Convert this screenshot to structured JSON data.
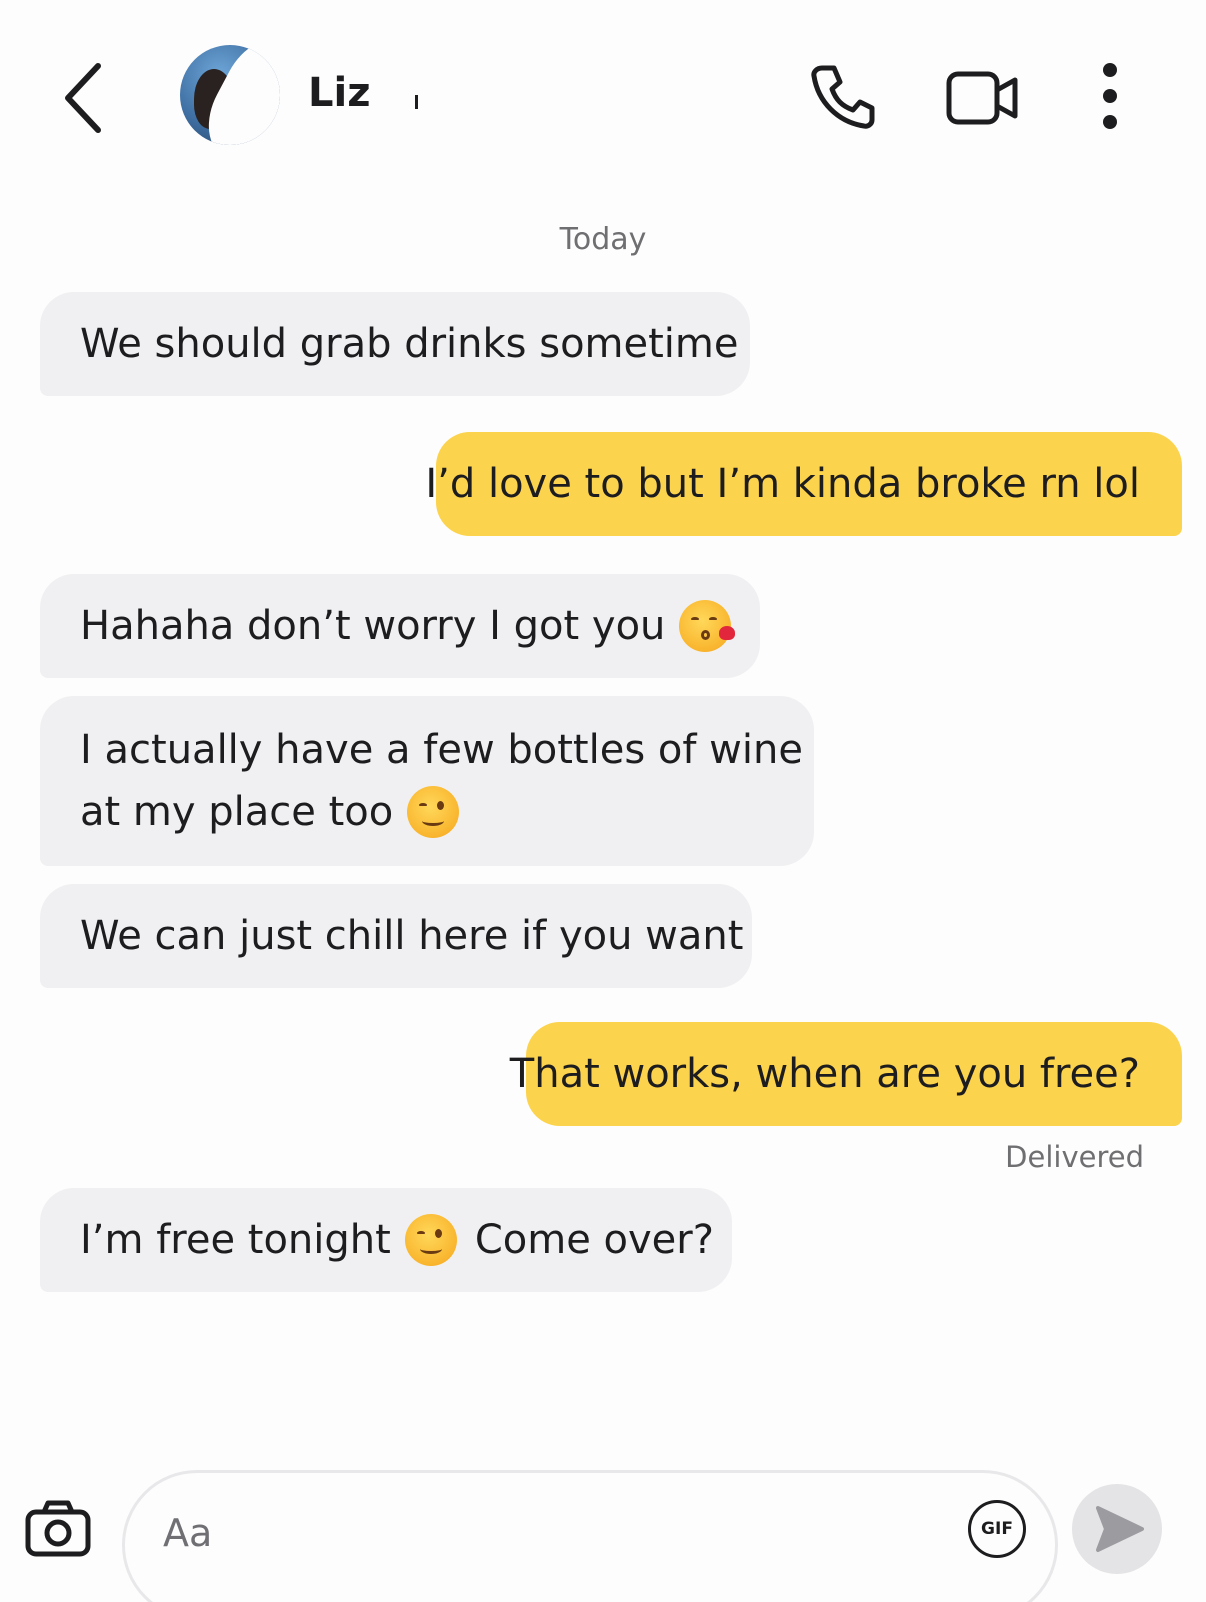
{
  "header": {
    "contact_name": "Liz"
  },
  "conversation": {
    "date_label": "Today",
    "messages": [
      {
        "direction": "incoming",
        "text": "We should grab drinks sometime"
      },
      {
        "direction": "outgoing",
        "text": "I’d love to but I’m kinda broke rn lol"
      },
      {
        "direction": "incoming",
        "text": "Hahaha don’t worry I got you",
        "emoji": "kissing-heart-emoji"
      },
      {
        "direction": "incoming",
        "text_line1": "I actually have a few bottles of wine",
        "text_line2": "at my place too",
        "emoji": "wink-emoji"
      },
      {
        "direction": "incoming",
        "text": "We can just chill here if you want"
      },
      {
        "direction": "outgoing",
        "text": "That works, when are you free?"
      },
      {
        "direction": "incoming",
        "text_before": "I’m free tonight",
        "emoji": "wink-emoji",
        "text_after": "Come over?"
      }
    ],
    "status": "Delivered"
  },
  "composer": {
    "placeholder": "Aa",
    "gif_label": "GIF"
  },
  "colors": {
    "incoming_bubble": "#f0f0f2",
    "outgoing_bubble": "#fcd34d",
    "background": "#fdfdfd"
  },
  "icons": [
    "back-icon",
    "phone-icon",
    "video-icon",
    "more-icon",
    "camera-icon",
    "gif-icon",
    "send-icon"
  ]
}
